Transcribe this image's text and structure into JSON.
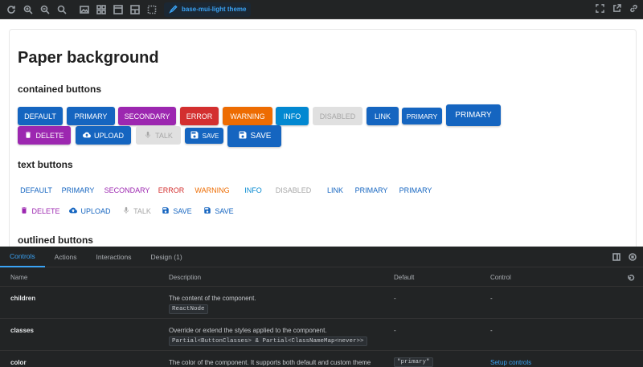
{
  "toolbar": {
    "theme_label": "base-mui-light theme",
    "icons": [
      "refresh-icon",
      "zoom-in-icon",
      "zoom-out-icon",
      "zoom-reset-icon",
      "image-icon",
      "grid-icon",
      "layout-icon",
      "outline-icon",
      "measure-icon"
    ],
    "right_icons": [
      "fullscreen-icon",
      "open-new-icon",
      "link-icon"
    ]
  },
  "preview": {
    "title": "Paper background",
    "contained_heading": "contained buttons",
    "text_heading": "text buttons",
    "outlined_heading": "outlined buttons",
    "contained_row1": [
      {
        "label": "Default",
        "color": "#1565c0"
      },
      {
        "label": "Primary",
        "color": "#1565c0"
      },
      {
        "label": "Secondary",
        "color": "#9c27b0"
      },
      {
        "label": "Error",
        "color": "#d32f2f"
      },
      {
        "label": "Warning",
        "color": "#ed6c02"
      },
      {
        "label": "Info",
        "color": "#0288d1"
      },
      {
        "label": "Disabled",
        "color": "#e0e0e0",
        "text": "#a6a6a6"
      },
      {
        "label": "Link",
        "color": "#1565c0"
      },
      {
        "label": "Primary",
        "color": "#1565c0"
      },
      {
        "label": "Primary",
        "color": "#1565c0"
      }
    ],
    "contained_row2": [
      {
        "label": "Delete",
        "color": "#9c27b0",
        "icon": "trash-icon"
      },
      {
        "label": "Upload",
        "color": "#1565c0",
        "icon": "cloud-upload-icon"
      },
      {
        "label": "Talk",
        "color": "#e0e0e0",
        "text": "#a6a6a6",
        "icon": "mic-icon"
      },
      {
        "label": "Save",
        "color": "#1565c0",
        "icon": "save-icon"
      },
      {
        "label": "Save",
        "color": "#1565c0",
        "icon": "save-icon"
      }
    ],
    "text_row1": [
      {
        "label": "Default",
        "color": "#1565c0"
      },
      {
        "label": "Primary",
        "color": "#1565c0"
      },
      {
        "label": "Secondary",
        "color": "#9c27b0"
      },
      {
        "label": "Error",
        "color": "#d32f2f"
      },
      {
        "label": "Warning",
        "color": "#ed6c02"
      },
      {
        "label": "Info",
        "color": "#0288d1"
      },
      {
        "label": "Disabled",
        "color": "#a6a6a6"
      },
      {
        "label": "Link",
        "color": "#1565c0"
      },
      {
        "label": "Primary",
        "color": "#1565c0"
      },
      {
        "label": "Primary",
        "color": "#1565c0"
      }
    ],
    "text_row2": [
      {
        "label": "Delete",
        "color": "#9c27b0",
        "icon": "trash-icon"
      },
      {
        "label": "Upload",
        "color": "#1565c0",
        "icon": "cloud-upload-icon"
      },
      {
        "label": "Talk",
        "color": "#a6a6a6",
        "icon": "mic-icon"
      },
      {
        "label": "Save",
        "color": "#1565c0",
        "icon": "save-icon"
      },
      {
        "label": "Save",
        "color": "#1565c0",
        "icon": "save-icon"
      }
    ]
  },
  "panel": {
    "tabs": [
      "Controls",
      "Actions",
      "Interactions",
      "Design (1)"
    ],
    "active_tab": "Controls",
    "columns": {
      "name": "Name",
      "description": "Description",
      "default": "Default",
      "control": "Control"
    },
    "rows": [
      {
        "name": "children",
        "description": "The content of the component.",
        "type": "ReactNode",
        "default": "-",
        "control": "-"
      },
      {
        "name": "classes",
        "description": "Override or extend the styles applied to the component.",
        "type": "Partial<ButtonClasses> & Partial<ClassNameMap<never>>",
        "default": "-",
        "control": "-"
      },
      {
        "name": "color",
        "description": "The color of the component. It supports both default and custom theme",
        "type": "",
        "default": "\"primary\"",
        "control": "Setup controls"
      }
    ]
  }
}
